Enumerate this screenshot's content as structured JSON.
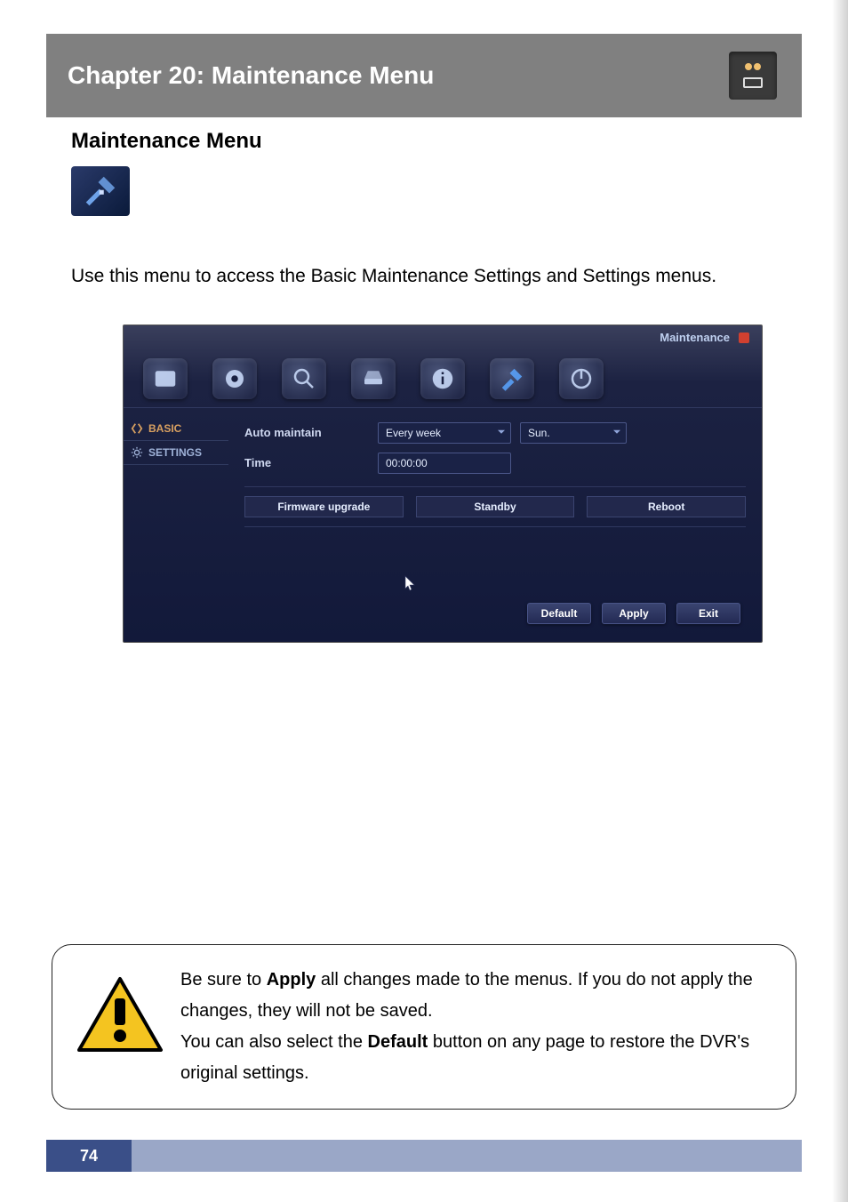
{
  "chapter": {
    "title": "Chapter 20: Maintenance Menu"
  },
  "section": {
    "heading": "Maintenance Menu"
  },
  "intro": {
    "text": "Use this menu to access the Basic Maintenance Settings and Settings menus."
  },
  "dvr": {
    "header_title": "Maintenance",
    "sidebar": {
      "items": [
        {
          "label": "BASIC"
        },
        {
          "label": "SETTINGS"
        }
      ]
    },
    "fields": {
      "auto_maintain_label": "Auto maintain",
      "auto_maintain_period": "Every week",
      "auto_maintain_day": "Sun.",
      "time_label": "Time",
      "time_value": "00:00:00"
    },
    "action_buttons": {
      "firmware": "Firmware upgrade",
      "standby": "Standby",
      "reboot": "Reboot"
    },
    "footer_buttons": {
      "default": "Default",
      "apply": "Apply",
      "exit": "Exit"
    }
  },
  "callout": {
    "line1_pre": "Be sure to ",
    "bold_apply": "Apply",
    "line1_post": " all changes made to the menus. If you do not apply the changes, they will not be saved.",
    "line2_pre": "You can also select the ",
    "bold_default": "Default",
    "line2_post": " button on any page to restore the DVR's original settings."
  },
  "page": {
    "number": "74"
  }
}
